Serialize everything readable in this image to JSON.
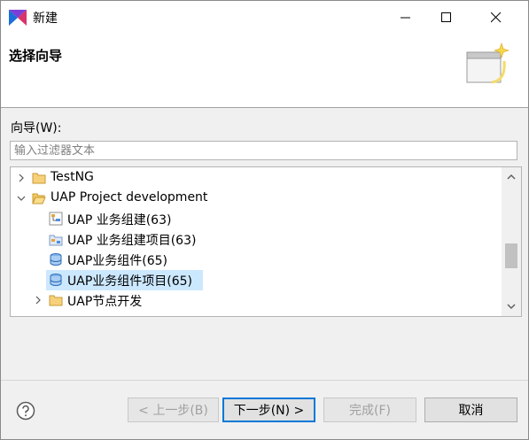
{
  "window": {
    "title": "新建"
  },
  "banner": {
    "title": "选择向导"
  },
  "filter": {
    "label": "向导(W):",
    "placeholder": "输入过滤器文本"
  },
  "tree": {
    "items": [
      {
        "label": "TestNG",
        "level": 0,
        "expanded": false,
        "icon": "folder-icon"
      },
      {
        "label": "UAP Project development",
        "level": 0,
        "expanded": true,
        "icon": "folder-open-icon"
      },
      {
        "label": "UAP 业务组建(63)",
        "level": 1,
        "icon": "component-icon"
      },
      {
        "label": "UAP 业务组建项目(63)",
        "level": 1,
        "icon": "component-project-icon"
      },
      {
        "label": "UAP业务组件(65)",
        "level": 1,
        "icon": "database-icon"
      },
      {
        "label": "UAP业务组件项目(65)",
        "level": 1,
        "icon": "database-icon",
        "selected": true
      },
      {
        "label": "UAP节点开发",
        "level": 1,
        "expanded": false,
        "icon": "folder-icon"
      }
    ],
    "scroll_position": 0.6
  },
  "buttons": {
    "back": "< 上一步(B)",
    "next": "下一步(N) >",
    "finish": "完成(F)",
    "cancel": "取消"
  },
  "colors": {
    "selection": "#cce8ff",
    "default_button_border": "#0078d7",
    "folder": "#e8b34a"
  }
}
